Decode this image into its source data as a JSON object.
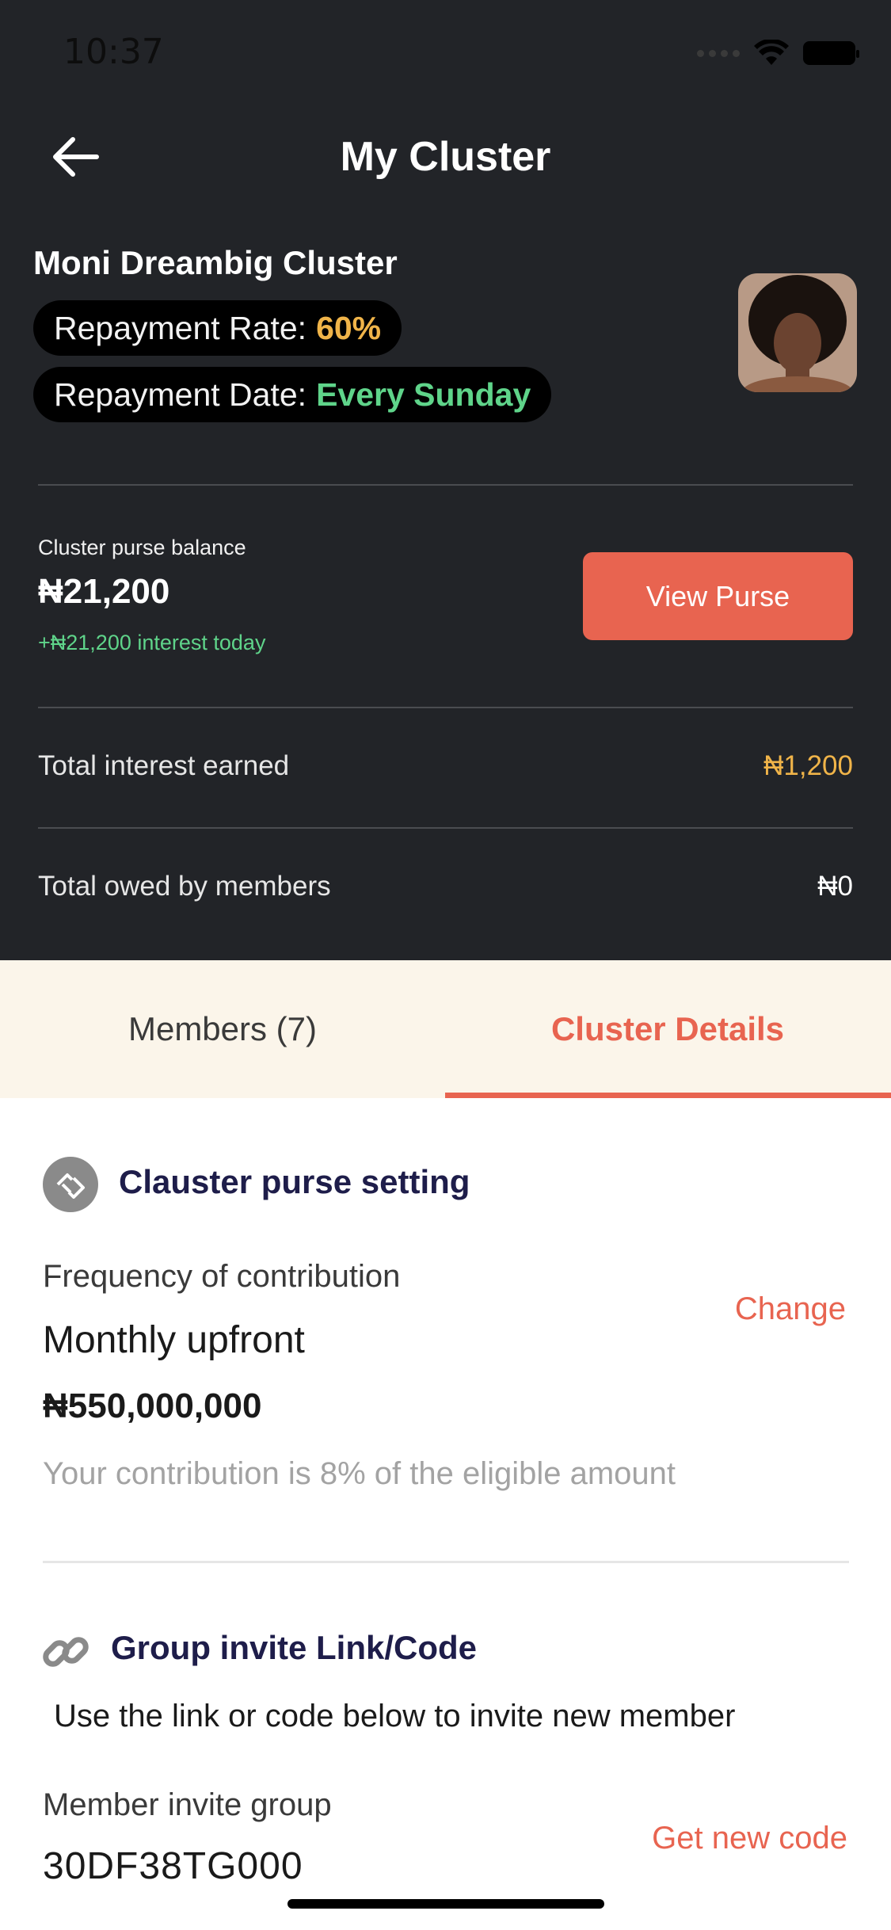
{
  "status_bar": {
    "time": "10:37"
  },
  "header": {
    "title": "My Cluster"
  },
  "cluster": {
    "name": "Moni Dreambig Cluster",
    "repayment_rate_label": "Repayment Rate:",
    "repayment_rate_value": "60%",
    "repayment_date_label": "Repayment Date:",
    "repayment_date_value": "Every Sunday"
  },
  "purse": {
    "label": "Cluster purse balance",
    "amount": "₦21,200",
    "interest": "+₦21,200 interest today",
    "view_button": "View Purse"
  },
  "stats": {
    "interest_label": "Total interest earned",
    "interest_value": "₦1,200",
    "owed_label": "Total owed by members",
    "owed_value": "₦0"
  },
  "tabs": {
    "members": "Members (7)",
    "details": "Cluster Details"
  },
  "purse_setting": {
    "title": "Clauster purse setting",
    "frequency_label": "Frequency of contribution",
    "frequency_value": "Monthly upfront",
    "change": "Change",
    "amount": "₦550,000,000",
    "note": "Your contribution is 8% of the eligible amount"
  },
  "invite": {
    "title": "Group invite Link/Code",
    "description": "Use the link or code below to invite new member",
    "label": "Member invite group",
    "code": "30DF38TG000",
    "new_code": "Get new code"
  },
  "colors": {
    "dark_bg": "#222428",
    "accent": "#e86450",
    "green": "#5fd48a",
    "gold": "#f0b449",
    "tab_bg": "#fbf5ea",
    "navy": "#1e1d4a"
  }
}
